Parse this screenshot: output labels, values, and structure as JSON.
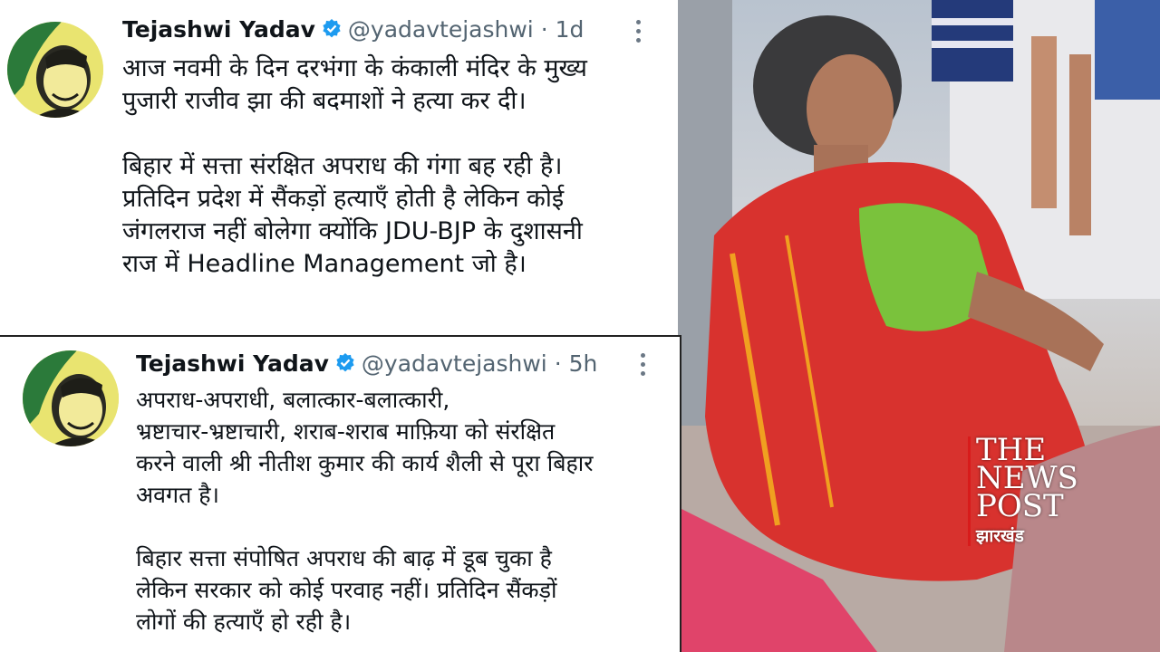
{
  "tweets": [
    {
      "name": "Tejashwi Yadav",
      "handle": "@yadavtejashwi",
      "separator": "·",
      "time": "1d",
      "lines": [
        "आज नवमी के दिन दरभंगा के कंकाली मंदिर के मुख्य",
        "पुजारी राजीव झा की बदमाशों ने हत्या कर दी।",
        "",
        "बिहार में सत्ता संरक्षित अपराध की गंगा बह रही है।",
        "प्रतिदिन प्रदेश में सैंकड़ों हत्याएँ होती है लेकिन कोई",
        "जंगलराज नहीं बोलेगा क्योंकि JDU-BJP के दुशासनी",
        "राज में Headline Management जो है।"
      ]
    },
    {
      "name": "Tejashwi Yadav",
      "handle": "@yadavtejashwi",
      "separator": "·",
      "time": "5h",
      "lines": [
        "अपराध-अपराधी, बलात्कार-बलात्कारी,",
        "भ्रष्टाचार-भ्रष्टाचारी, शराब-शराब माफ़िया को संरक्षित",
        "करने वाली श्री नीतीश कुमार की कार्य शैली से पूरा बिहार",
        "अवगत है।",
        "",
        "बिहार सत्ता संपोषित अपराध की बाढ़ में डूब चुका है",
        "लेकिन सरकार को कोई परवाह नहीं। प्रतिदिन सैंकड़ों",
        "लोगों की हत्याएँ हो रही है।"
      ]
    }
  ],
  "watermark": {
    "line1": "THE",
    "line2": "NEWS",
    "line3": "POST",
    "sub": "झारखंड"
  },
  "colors": {
    "verified": "#1d9bf0",
    "text": "#0f1419",
    "muted": "#536471",
    "accent": "#d81b1b"
  },
  "icons": [
    "verified-badge-icon",
    "more-options-icon",
    "avatar"
  ]
}
